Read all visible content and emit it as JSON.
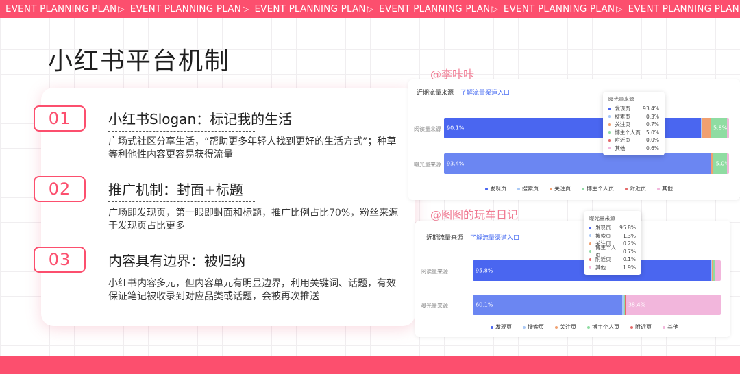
{
  "ribbon": {
    "text": "EVENT PLANNING PLAN",
    "repeat": 6
  },
  "title": "小红书平台机制",
  "items": [
    {
      "num": "01",
      "title": "小红书Slogan：标记我的生活",
      "desc": "广场式社区分享生活，“帮助更多年轻人找到更好的生活方式”；种草等利他性内容更容易获得流量"
    },
    {
      "num": "02",
      "title": "推广机制：封面+标题",
      "desc": "广场即发现页，第一眼即封面和标题，推广比例占比70%，粉丝来源于发现页占比更多"
    },
    {
      "num": "03",
      "title": "内容具有边界：被归纳",
      "desc": "小红书内容多元，但内容单元有明显边界，利用关键词、话题，有效保证笔记被收录到对应品类或话题，会被再次推送"
    }
  ],
  "colors": {
    "accent": "#fc4f6e",
    "source_colors": [
      "#4a66f0",
      "#a9c8f5",
      "#f0a070",
      "#8fdca2",
      "#e46a6a",
      "#f2b6dc"
    ]
  },
  "chart_data": [
    {
      "type": "bar",
      "orientation": "horizontal",
      "stacked": true,
      "watermark": "@李咔咔",
      "heading": "近期流量来源",
      "link": "了解流量渠道入口",
      "categories": [
        "阅读量来源",
        "曝光量来源"
      ],
      "series_names": [
        "发现页",
        "搜索页",
        "关注页",
        "博主个人页",
        "附近页",
        "其他"
      ],
      "rows": [
        {
          "label": "阅读量来源",
          "values": [
            90.1,
            0.4,
            3.0,
            5.8,
            0.1,
            0.6
          ],
          "shown_labels": [
            "90.1%",
            "",
            "",
            "5.8%",
            "",
            ""
          ]
        },
        {
          "label": "曝光量来源",
          "values": [
            93.4,
            0.3,
            0.7,
            5.0,
            0.0,
            0.6
          ],
          "shown_labels": [
            "93.4%",
            "",
            "",
            "5.0%",
            "",
            ""
          ]
        }
      ],
      "tooltip": {
        "title": "曝光量来源",
        "rows": [
          {
            "name": "发现页",
            "pct": "93.4%"
          },
          {
            "name": "搜索页",
            "pct": "0.3%"
          },
          {
            "name": "关注页",
            "pct": "0.7%"
          },
          {
            "name": "博主个人页",
            "pct": "5.0%"
          },
          {
            "name": "附近页",
            "pct": "0.0%"
          },
          {
            "name": "其他",
            "pct": "0.6%"
          }
        ]
      },
      "legend": [
        "发现页",
        "搜索页",
        "关注页",
        "博主个人页",
        "附近页",
        "其他"
      ]
    },
    {
      "type": "bar",
      "orientation": "horizontal",
      "stacked": true,
      "watermark": "@图图的玩车日记",
      "heading": "近期流量来源",
      "link": "了解流量渠道入口",
      "categories": [
        "阅读量来源",
        "曝光量来源"
      ],
      "series_names": [
        "发现页",
        "搜索页",
        "关注页",
        "博主个人页",
        "附近页",
        "其他"
      ],
      "rows": [
        {
          "label": "阅读量来源",
          "values": [
            95.8,
            0.6,
            0.2,
            1.0,
            0.1,
            2.3
          ],
          "shown_labels": [
            "95.8%",
            "",
            "",
            "",
            "",
            ""
          ]
        },
        {
          "label": "曝光量来源",
          "values": [
            60.1,
            0.5,
            0.2,
            0.6,
            0.1,
            38.4
          ],
          "shown_labels": [
            "60.1%",
            "",
            "",
            "",
            "",
            "38.4%"
          ]
        }
      ],
      "tooltip": {
        "title": "曝光量来源",
        "rows": [
          {
            "name": "发现页",
            "pct": "95.8%"
          },
          {
            "name": "搜索页",
            "pct": "1.3%"
          },
          {
            "name": "关注页",
            "pct": "0.2%"
          },
          {
            "name": "博主个人页",
            "pct": "0.7%"
          },
          {
            "name": "附近页",
            "pct": "0.1%"
          },
          {
            "name": "其他",
            "pct": "1.9%"
          }
        ]
      },
      "legend": [
        "发现页",
        "搜索页",
        "关注页",
        "博主个人页",
        "附近页",
        "其他"
      ]
    }
  ]
}
